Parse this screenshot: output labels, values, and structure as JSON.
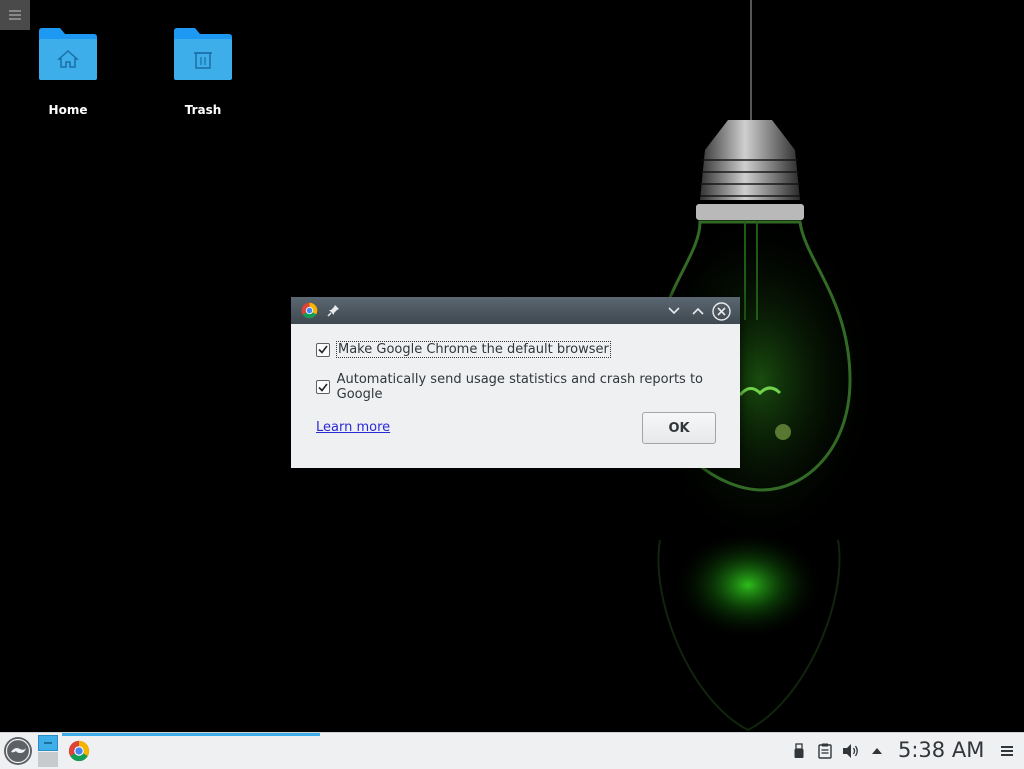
{
  "desktop": {
    "icons": [
      {
        "label": "Home",
        "icon": "home-folder-icon"
      },
      {
        "label": "Trash",
        "icon": "trash-folder-icon"
      }
    ]
  },
  "dialog": {
    "app_icon": "chrome-icon",
    "checkboxes": [
      {
        "label": "Make Google Chrome the default browser",
        "checked": true
      },
      {
        "label": "Automatically send usage statistics and crash reports to Google",
        "checked": true
      }
    ],
    "learn_more": "Learn more",
    "ok": "OK"
  },
  "taskbar": {
    "clock": "5:38 AM",
    "tray_icons": [
      "usb-icon",
      "clipboard-icon",
      "volume-icon",
      "expand-tray-icon",
      "menu-icon"
    ]
  },
  "colors": {
    "accent": "#3daee9",
    "titlebar": "#4d5962",
    "dialog_bg": "#eff0f1",
    "panel_bg": "#eff0f1",
    "link": "#2a2ad4"
  }
}
